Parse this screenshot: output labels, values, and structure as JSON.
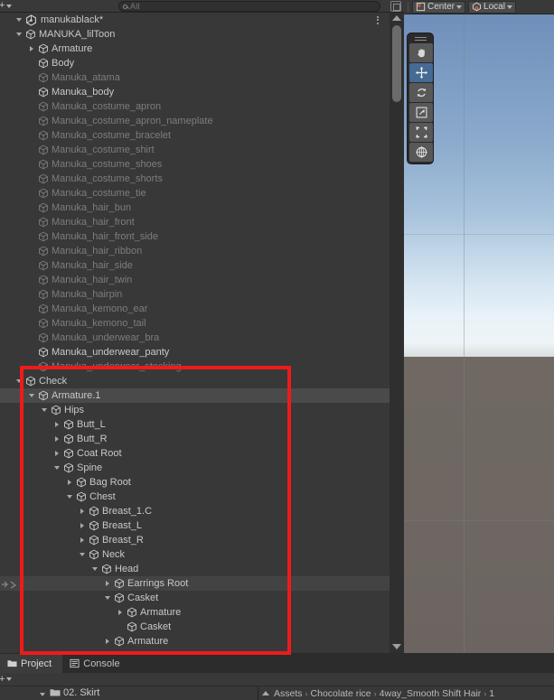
{
  "hierarchy": {
    "toolbar": {
      "create_label": "+",
      "create_icon": "plus-icon",
      "dropdown_icon": "chevron-down-icon",
      "search_icon": "search-icon",
      "search_placeholder": "All",
      "search_value": "",
      "right_icon": "window-layout-icon"
    },
    "scene_name": "manukablack*",
    "scene_icon": "unity-scene-icon",
    "overflow_icon": "kebab-menu-icon",
    "rows": [
      {
        "label": "MANUKA_lilToon",
        "indent": 1,
        "twisty": "open",
        "dim": false,
        "state": "normal"
      },
      {
        "label": "Armature",
        "indent": 2,
        "twisty": "closed",
        "dim": false,
        "state": "normal"
      },
      {
        "label": "Body",
        "indent": 2,
        "twisty": "none",
        "dim": false,
        "state": "normal"
      },
      {
        "label": "Manuka_atama",
        "indent": 2,
        "twisty": "none",
        "dim": true,
        "state": "normal"
      },
      {
        "label": "Manuka_body",
        "indent": 2,
        "twisty": "none",
        "dim": false,
        "state": "normal"
      },
      {
        "label": "Manuka_costume_apron",
        "indent": 2,
        "twisty": "none",
        "dim": true,
        "state": "normal"
      },
      {
        "label": "Manuka_costume_apron_nameplate",
        "indent": 2,
        "twisty": "none",
        "dim": true,
        "state": "normal"
      },
      {
        "label": "Manuka_costume_bracelet",
        "indent": 2,
        "twisty": "none",
        "dim": true,
        "state": "normal"
      },
      {
        "label": "Manuka_costume_shirt",
        "indent": 2,
        "twisty": "none",
        "dim": true,
        "state": "normal"
      },
      {
        "label": "Manuka_costume_shoes",
        "indent": 2,
        "twisty": "none",
        "dim": true,
        "state": "normal"
      },
      {
        "label": "Manuka_costume_shorts",
        "indent": 2,
        "twisty": "none",
        "dim": true,
        "state": "normal"
      },
      {
        "label": "Manuka_costume_tie",
        "indent": 2,
        "twisty": "none",
        "dim": true,
        "state": "normal"
      },
      {
        "label": "Manuka_hair_bun",
        "indent": 2,
        "twisty": "none",
        "dim": true,
        "state": "normal"
      },
      {
        "label": "Manuka_hair_front",
        "indent": 2,
        "twisty": "none",
        "dim": true,
        "state": "normal"
      },
      {
        "label": "Manuka_hair_front_side",
        "indent": 2,
        "twisty": "none",
        "dim": true,
        "state": "normal"
      },
      {
        "label": "Manuka_hair_ribbon",
        "indent": 2,
        "twisty": "none",
        "dim": true,
        "state": "normal"
      },
      {
        "label": "Manuka_hair_side",
        "indent": 2,
        "twisty": "none",
        "dim": true,
        "state": "normal"
      },
      {
        "label": "Manuka_hair_twin",
        "indent": 2,
        "twisty": "none",
        "dim": true,
        "state": "normal"
      },
      {
        "label": "Manuka_hairpin",
        "indent": 2,
        "twisty": "none",
        "dim": true,
        "state": "normal"
      },
      {
        "label": "Manuka_kemono_ear",
        "indent": 2,
        "twisty": "none",
        "dim": true,
        "state": "normal"
      },
      {
        "label": "Manuka_kemono_tail",
        "indent": 2,
        "twisty": "none",
        "dim": true,
        "state": "normal"
      },
      {
        "label": "Manuka_underwear_bra",
        "indent": 2,
        "twisty": "none",
        "dim": true,
        "state": "normal"
      },
      {
        "label": "Manuka_underwear_panty",
        "indent": 2,
        "twisty": "none",
        "dim": false,
        "state": "normal"
      },
      {
        "label": "Manuka_underwear_stocking",
        "indent": 2,
        "twisty": "none",
        "dim": true,
        "state": "normal"
      },
      {
        "label": "Check",
        "indent": 1,
        "twisty": "open",
        "dim": false,
        "state": "normal"
      },
      {
        "label": "Armature.1",
        "indent": 2,
        "twisty": "open",
        "dim": false,
        "state": "selected"
      },
      {
        "label": "Hips",
        "indent": 3,
        "twisty": "open",
        "dim": false,
        "state": "normal"
      },
      {
        "label": "Butt_L",
        "indent": 4,
        "twisty": "closed",
        "dim": false,
        "state": "normal"
      },
      {
        "label": "Butt_R",
        "indent": 4,
        "twisty": "closed",
        "dim": false,
        "state": "normal"
      },
      {
        "label": "Coat Root",
        "indent": 4,
        "twisty": "closed",
        "dim": false,
        "state": "normal"
      },
      {
        "label": "Spine",
        "indent": 4,
        "twisty": "open",
        "dim": false,
        "state": "normal"
      },
      {
        "label": "Bag Root",
        "indent": 5,
        "twisty": "closed",
        "dim": false,
        "state": "normal"
      },
      {
        "label": "Chest",
        "indent": 5,
        "twisty": "open",
        "dim": false,
        "state": "normal"
      },
      {
        "label": "Breast_1.C",
        "indent": 6,
        "twisty": "closed",
        "dim": false,
        "state": "normal"
      },
      {
        "label": "Breast_L",
        "indent": 6,
        "twisty": "closed",
        "dim": false,
        "state": "normal"
      },
      {
        "label": "Breast_R",
        "indent": 6,
        "twisty": "closed",
        "dim": false,
        "state": "normal"
      },
      {
        "label": "Neck",
        "indent": 6,
        "twisty": "open",
        "dim": false,
        "state": "normal"
      },
      {
        "label": "Head",
        "indent": 7,
        "twisty": "open",
        "dim": false,
        "state": "normal"
      },
      {
        "label": "Earrings Root",
        "indent": 8,
        "twisty": "closed",
        "dim": false,
        "state": "hovered"
      },
      {
        "label": "Casket",
        "indent": 8,
        "twisty": "open",
        "dim": false,
        "state": "normal"
      },
      {
        "label": "Armature",
        "indent": 9,
        "twisty": "closed",
        "dim": false,
        "state": "normal"
      },
      {
        "label": "Casket",
        "indent": 9,
        "twisty": "none",
        "dim": false,
        "state": "normal"
      },
      {
        "label": "Armature",
        "indent": 8,
        "twisty": "closed",
        "dim": false,
        "state": "normal"
      }
    ],
    "scrollbar": {
      "up_icon": "scroll-up-arrow",
      "down_icon": "scroll-down-arrow"
    },
    "annotation": {
      "color": "#f11a1a"
    }
  },
  "scene_view": {
    "toolbar": {
      "pivot_mode_label": "Center",
      "pivot_mode_icon": "pivot-center-icon",
      "handle_space_label": "Local",
      "handle_space_icon": "handle-local-icon",
      "dropdown_icon": "chevron-down-icon"
    },
    "tools_overlay": {
      "grip_icon": "drag-grip-icon",
      "tools": [
        {
          "name": "hand-tool-icon",
          "active": false
        },
        {
          "name": "move-tool-icon",
          "active": true
        },
        {
          "name": "rotate-tool-icon",
          "active": false
        },
        {
          "name": "scale-tool-icon",
          "active": false
        },
        {
          "name": "rect-tool-icon",
          "active": false
        },
        {
          "name": "transform-tool-icon",
          "active": false
        }
      ]
    },
    "colors": {
      "sky_top": "#6f8fba",
      "sky_horizon": "#eef4f7",
      "ground": "#6e6762"
    }
  },
  "bottom": {
    "tabs": [
      {
        "label": "Project",
        "icon": "folder-icon",
        "active": true
      },
      {
        "label": "Console",
        "icon": "console-icon",
        "active": false
      }
    ],
    "project_toolbar": {
      "create_label": "+",
      "create_icon": "plus-icon",
      "dropdown_icon": "chevron-down-icon"
    },
    "folder_row": {
      "label": "02. Skirt",
      "icon": "folder-icon",
      "twisty": "open"
    },
    "breadcrumb": {
      "up_icon": "breadcrumb-up-icon",
      "items": [
        "Assets",
        "Chocolate rice",
        "4way_Smooth Shift Hair",
        "1"
      ],
      "separator": "›"
    }
  }
}
